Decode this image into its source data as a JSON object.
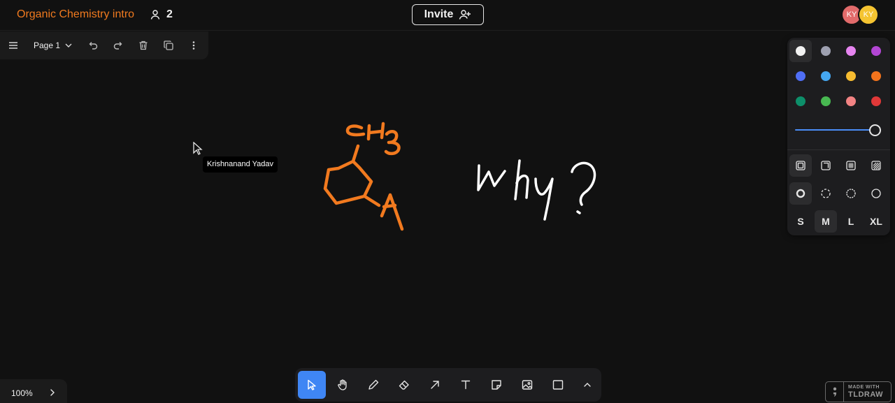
{
  "header": {
    "doc_title": "Organic Chemistry intro",
    "collaborator_count": "2",
    "invite_label": "Invite",
    "avatars": [
      {
        "initials": "KY",
        "color": "#e26b6b"
      },
      {
        "initials": "KY",
        "color": "#f5c431"
      }
    ]
  },
  "pagebar": {
    "menu_icon": "hamburger-menu-icon",
    "page_name": "Page 1",
    "dropdown_icon": "chevron-down-icon",
    "undo_icon": "undo-icon",
    "redo_icon": "redo-icon",
    "delete_icon": "trash-icon",
    "duplicate_icon": "duplicate-icon",
    "more_icon": "more-vertical-icon"
  },
  "canvas": {
    "cursor_label": "Krishnanand Yadav",
    "drawing_orange_color": "#f27a1f",
    "drawing_white_color": "#ffffff"
  },
  "style_panel": {
    "colors": [
      {
        "name": "white",
        "hex": "#f2f2f2",
        "selected": true
      },
      {
        "name": "grey",
        "hex": "#9ea0b0"
      },
      {
        "name": "light-violet",
        "hex": "#e685f0"
      },
      {
        "name": "violet",
        "hex": "#b346d4"
      },
      {
        "name": "blue",
        "hex": "#4f6ef5"
      },
      {
        "name": "light-blue",
        "hex": "#45a7f0"
      },
      {
        "name": "yellow",
        "hex": "#f7bc30"
      },
      {
        "name": "orange",
        "hex": "#f2731c"
      },
      {
        "name": "green",
        "hex": "#0d8f6a"
      },
      {
        "name": "light-green",
        "hex": "#48b851"
      },
      {
        "name": "light-red",
        "hex": "#f28383"
      },
      {
        "name": "red",
        "hex": "#e03838"
      }
    ],
    "opacity": 1.0,
    "fill_icons": [
      "fill-none-icon",
      "fill-semi-icon",
      "fill-solid-icon",
      "fill-pattern-icon"
    ],
    "dash_icons": [
      "dash-draw-icon",
      "dash-dashed-icon",
      "dash-dotted-icon",
      "dash-solid-icon"
    ],
    "sizes": [
      "S",
      "M",
      "L",
      "XL"
    ],
    "selected_size": "M"
  },
  "toolbar": {
    "tools": [
      {
        "name": "select",
        "icon": "cursor-arrow-icon",
        "active": true
      },
      {
        "name": "hand",
        "icon": "hand-icon"
      },
      {
        "name": "draw",
        "icon": "pencil-icon"
      },
      {
        "name": "eraser",
        "icon": "eraser-icon"
      },
      {
        "name": "arrow",
        "icon": "arrow-icon"
      },
      {
        "name": "text",
        "icon": "text-icon"
      },
      {
        "name": "note",
        "icon": "sticky-note-icon"
      },
      {
        "name": "media",
        "icon": "image-icon"
      },
      {
        "name": "rectangle",
        "icon": "rectangle-icon"
      },
      {
        "name": "more",
        "icon": "chevron-up-icon"
      }
    ]
  },
  "zoom": {
    "value": "100%"
  },
  "watermark": {
    "line1": "MADE WITH",
    "line2": "TLDRAW"
  }
}
